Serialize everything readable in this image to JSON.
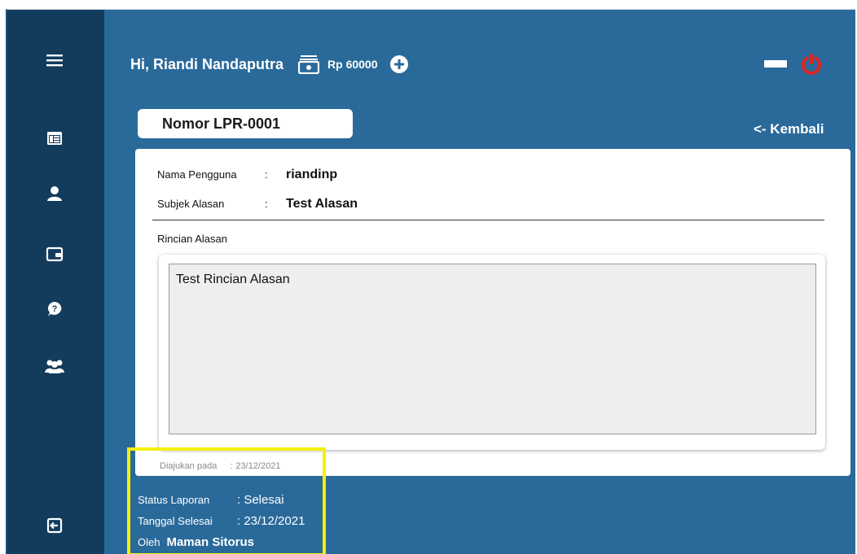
{
  "header": {
    "greeting": "Hi, Riandi Nandaputra",
    "balance": "Rp 60000"
  },
  "sidebar": {
    "items": [
      {
        "icon": "menu-icon"
      },
      {
        "icon": "dashboard-icon"
      },
      {
        "icon": "user-icon"
      },
      {
        "icon": "wallet-icon"
      },
      {
        "icon": "help-icon"
      },
      {
        "icon": "group-icon"
      },
      {
        "icon": "logout-icon"
      }
    ]
  },
  "ticket": {
    "number_label": "Nomor LPR-0001",
    "back_label": "<- Kembali",
    "username_label": "Nama Pengguna",
    "username_value": "riandinp",
    "subject_label": "Subjek Alasan",
    "subject_value": "Test Alasan",
    "detail_label": "Rincian Alasan",
    "detail_value": "Test Rincian Alasan",
    "submitted_label": "Diajukan pada",
    "submitted_value": "23/12/2021",
    "colon": ":"
  },
  "status": {
    "status_label": "Status Laporan",
    "status_value": ": Selesai",
    "done_date_label": "Tanggal Selesai",
    "done_date_value": ": 23/12/2021",
    "by_label": "Oleh",
    "by_value": "Maman Sitorus"
  },
  "colors": {
    "background": "#2a6a9a",
    "sidebar": "#133b5c",
    "power": "#e02424",
    "highlight": "#f4f10a"
  }
}
